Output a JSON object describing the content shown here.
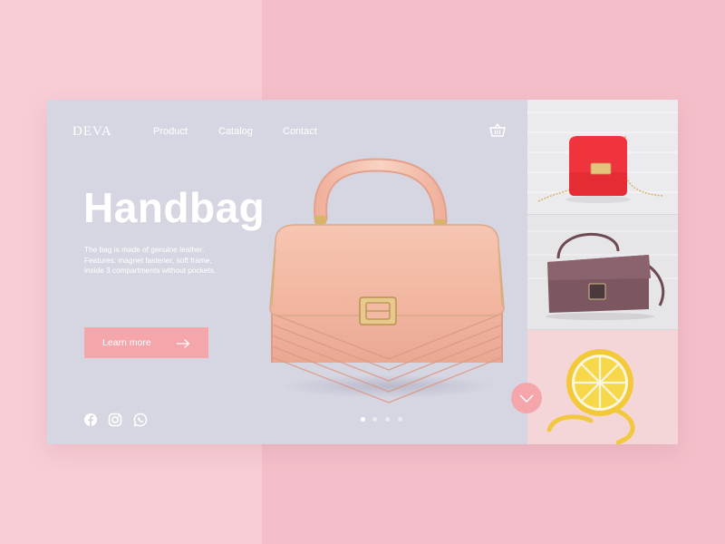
{
  "brand": {
    "logo": "DEVA"
  },
  "nav": {
    "items": [
      "Product",
      "Catalog",
      "Contact"
    ]
  },
  "hero": {
    "title": "Handbag",
    "description": [
      "The bag is made of genuine leather.",
      "Features: magnet fastener, soft frame,",
      "inside 3 compartments without pockets."
    ],
    "cta_label": "Learn more"
  },
  "socials": [
    "facebook-icon",
    "instagram-icon",
    "whatsapp-icon"
  ],
  "slider": {
    "current": 1,
    "total": 4
  },
  "gallery": [
    "red-handbag",
    "plum-crossbody-bag",
    "lemon-shaped-bag"
  ],
  "colors": {
    "background_left": "#f8cdd6",
    "background_right": "#f4bfca",
    "card": "#d6d6e2",
    "accent": "#f4a6ab"
  }
}
